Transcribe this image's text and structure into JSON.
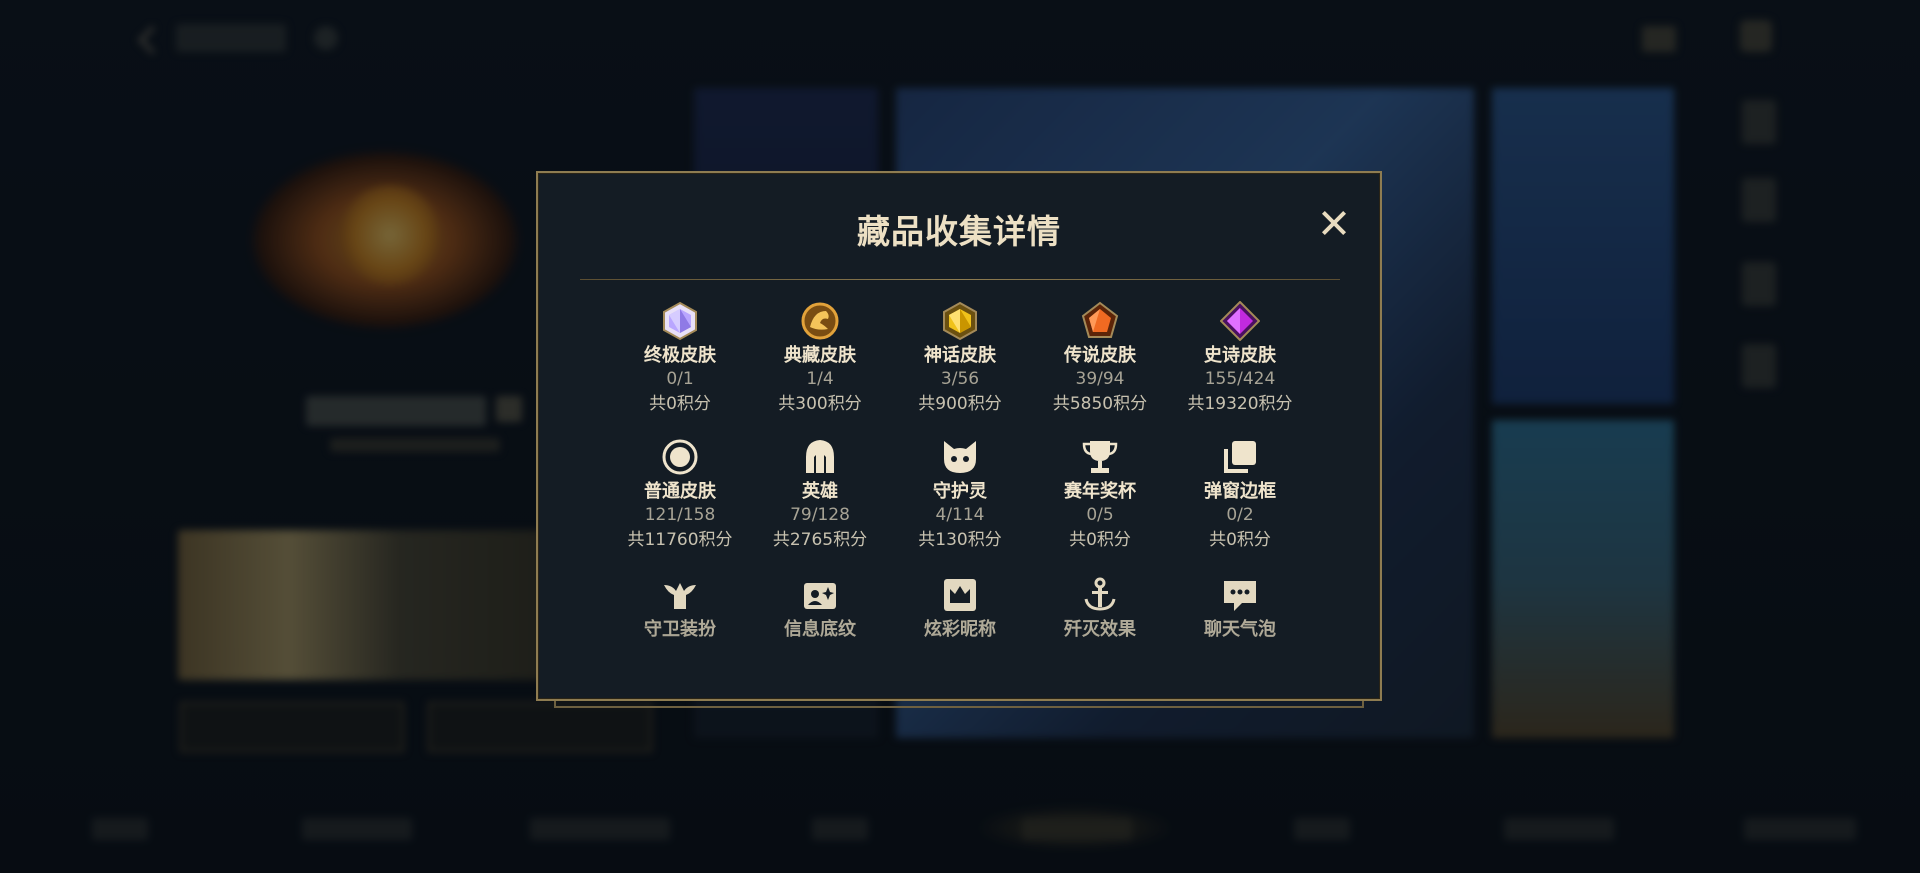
{
  "modal": {
    "title": "藏品收集详情"
  },
  "rows": [
    [
      {
        "label": "终极皮肤",
        "count": "0/1",
        "points": "共0积分",
        "icon": "ultimate-skin-gem-icon",
        "color": "#b9a6ff"
      },
      {
        "label": "典藏皮肤",
        "count": "1/4",
        "points": "共300积分",
        "icon": "collector-skin-dragon-icon",
        "color": "#e2a23a"
      },
      {
        "label": "神话皮肤",
        "count": "3/56",
        "points": "共900积分",
        "icon": "mythic-skin-gem-icon",
        "color": "#f0c21a"
      },
      {
        "label": "传说皮肤",
        "count": "39/94",
        "points": "共5850积分",
        "icon": "legend-skin-gem-icon",
        "color": "#f06a22"
      },
      {
        "label": "史诗皮肤",
        "count": "155/424",
        "points": "共19320积分",
        "icon": "epic-skin-gem-icon",
        "color": "#c12adf"
      }
    ],
    [
      {
        "label": "普通皮肤",
        "count": "121/158",
        "points": "共11760积分",
        "icon": "normal-skin-ring-icon"
      },
      {
        "label": "英雄",
        "count": "79/128",
        "points": "共2765积分",
        "icon": "hero-helmet-icon"
      },
      {
        "label": "守护灵",
        "count": "4/114",
        "points": "共130积分",
        "icon": "guardian-spirit-icon"
      },
      {
        "label": "赛年奖杯",
        "count": "0/5",
        "points": "共0积分",
        "icon": "season-trophy-icon"
      },
      {
        "label": "弹窗边框",
        "count": "0/2",
        "points": "共0积分",
        "icon": "popup-frame-icon"
      }
    ],
    [
      {
        "label": "守卫装扮",
        "icon": "guard-outfit-icon"
      },
      {
        "label": "信息底纹",
        "icon": "info-background-icon"
      },
      {
        "label": "炫彩昵称",
        "icon": "colorful-nickname-icon"
      },
      {
        "label": "歼灭效果",
        "icon": "annihilation-effect-icon"
      },
      {
        "label": "聊天气泡",
        "icon": "chat-bubble-icon"
      }
    ]
  ],
  "colors": {
    "panel_bg": "#141c24",
    "panel_border": "#8e7c51",
    "text_primary": "#efe4cc",
    "text_secondary": "#a7a395"
  }
}
